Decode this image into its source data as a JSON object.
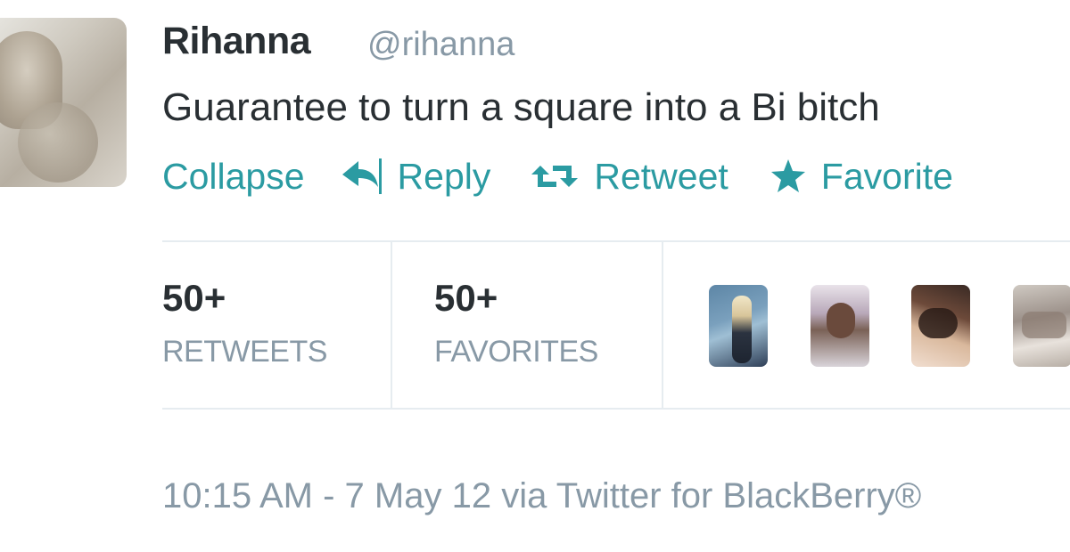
{
  "tweet": {
    "author_name": "Rihanna",
    "author_handle": "@rihanna",
    "text": "Guarantee to turn a square into a Bi bitch",
    "actions": {
      "collapse": "Collapse",
      "reply": "Reply",
      "retweet": "Retweet",
      "favorite": "Favorite"
    },
    "stats": {
      "retweets_count": "50+",
      "retweets_label": "RETWEETS",
      "favorites_count": "50+",
      "favorites_label": "FAVORITES"
    },
    "timestamp": "10:15 AM - 7 May 12 via Twitter for BlackBerry®"
  },
  "icons": {
    "reply": "reply-arrow-icon",
    "retweet": "retweet-arrows-icon",
    "favorite": "star-icon"
  },
  "colors": {
    "accent": "#2b9ba2",
    "primary_text": "#292f33",
    "secondary_text": "#8899a6",
    "divider": "#e6ecf0"
  }
}
